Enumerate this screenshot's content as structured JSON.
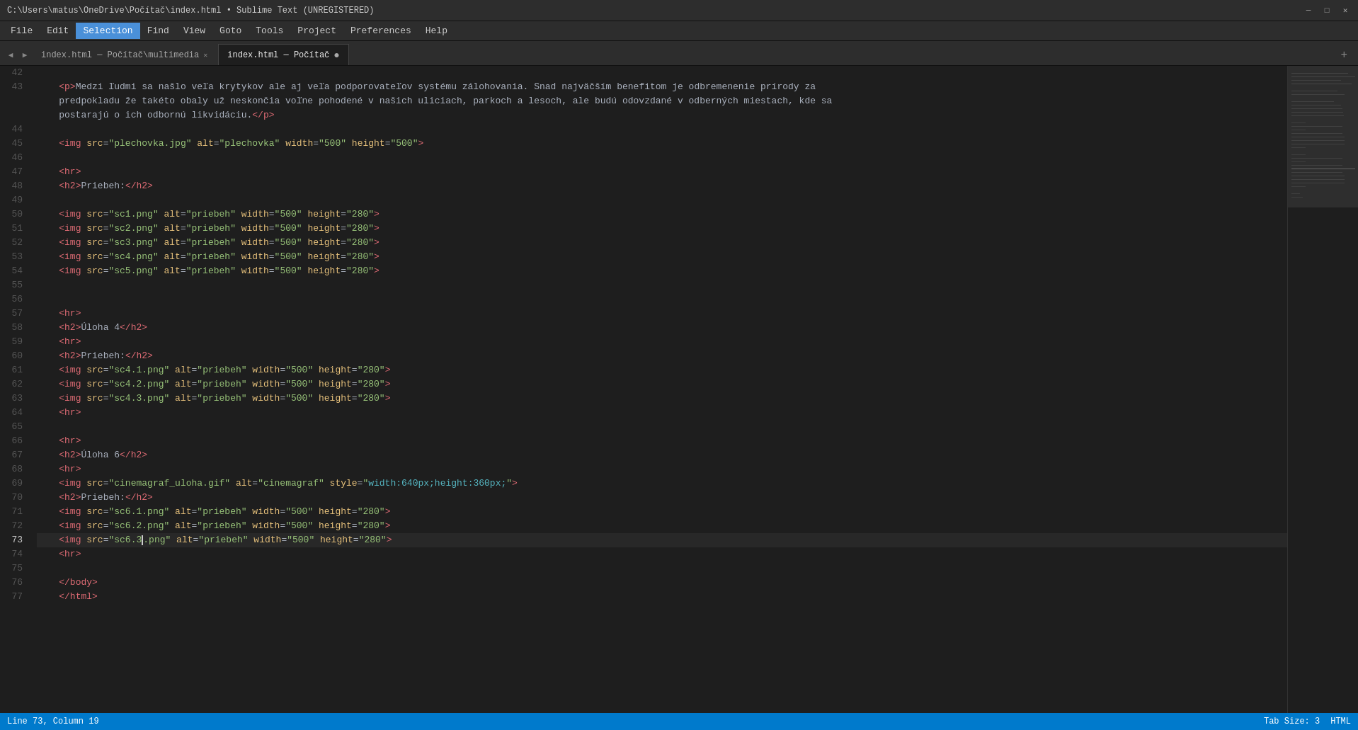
{
  "titlebar": {
    "title": "C:\\Users\\matus\\OneDrive\\Počítač\\index.html • Sublime Text (UNREGISTERED)",
    "min_label": "─",
    "max_label": "□",
    "close_label": "✕"
  },
  "menubar": {
    "items": [
      {
        "id": "file",
        "label": "File"
      },
      {
        "id": "edit",
        "label": "Edit"
      },
      {
        "id": "selection",
        "label": "Selection",
        "active": true
      },
      {
        "id": "find",
        "label": "Find"
      },
      {
        "id": "view",
        "label": "View"
      },
      {
        "id": "goto",
        "label": "Goto"
      },
      {
        "id": "tools",
        "label": "Tools"
      },
      {
        "id": "project",
        "label": "Project"
      },
      {
        "id": "preferences",
        "label": "Preferences"
      },
      {
        "id": "help",
        "label": "Help"
      }
    ]
  },
  "tabbar": {
    "tabs": [
      {
        "id": "tab1",
        "label": "index.html — Počítač\\multimedia",
        "active": false,
        "dirty": false
      },
      {
        "id": "tab2",
        "label": "index.html — Počítač",
        "active": true,
        "dirty": true
      }
    ]
  },
  "editor": {
    "lines": [
      {
        "num": 42,
        "content": ""
      },
      {
        "num": 43,
        "content": "    <p>Medzi ľudmi sa našlo veľa krytykov ale aj veľa podporovateľov systému zálohovania. Snad najväčším benefitom je odbremenenie prírody za"
      },
      {
        "num": "",
        "content": "    predpokladu že takéto obaly už neskončia voľne pohodené v našich uliciach, parkoch a lesoch, ale budú odovzdané v odberných miestach, kde sa"
      },
      {
        "num": "",
        "content": "    postarajú o ich odbornú likvidáciu.</p>"
      },
      {
        "num": 44,
        "content": ""
      },
      {
        "num": 45,
        "content": "    <img src=\"plechovka.jpg\" alt=\"plechovka\" width=\"500\" height=\"500\">"
      },
      {
        "num": 46,
        "content": ""
      },
      {
        "num": 47,
        "content": "    <hr>"
      },
      {
        "num": 48,
        "content": "    <h2>Priebeh:</h2>"
      },
      {
        "num": 49,
        "content": ""
      },
      {
        "num": 50,
        "content": "    <img src=\"sc1.png\" alt=\"priebeh\" width=\"500\" height=\"280\">"
      },
      {
        "num": 51,
        "content": "    <img src=\"sc2.png\" alt=\"priebeh\" width=\"500\" height=\"280\">"
      },
      {
        "num": 52,
        "content": "    <img src=\"sc3.png\" alt=\"priebeh\" width=\"500\" height=\"280\">"
      },
      {
        "num": 53,
        "content": "    <img src=\"sc4.png\" alt=\"priebeh\" width=\"500\" height=\"280\">"
      },
      {
        "num": 54,
        "content": "    <img src=\"sc5.png\" alt=\"priebeh\" width=\"500\" height=\"280\">"
      },
      {
        "num": 55,
        "content": ""
      },
      {
        "num": 56,
        "content": ""
      },
      {
        "num": 57,
        "content": "    <hr>"
      },
      {
        "num": 58,
        "content": "    <h2>Úloha 4</h2>"
      },
      {
        "num": 59,
        "content": "    <hr>"
      },
      {
        "num": 60,
        "content": "    <h2>Priebeh:</h2>"
      },
      {
        "num": 61,
        "content": "    <img src=\"sc4.1.png\" alt=\"priebeh\" width=\"500\" height=\"280\">"
      },
      {
        "num": 62,
        "content": "    <img src=\"sc4.2.png\" alt=\"priebeh\" width=\"500\" height=\"280\">"
      },
      {
        "num": 63,
        "content": "    <img src=\"sc4.3.png\" alt=\"priebeh\" width=\"500\" height=\"280\">"
      },
      {
        "num": 64,
        "content": "    <hr>"
      },
      {
        "num": 65,
        "content": ""
      },
      {
        "num": 66,
        "content": "    <hr>"
      },
      {
        "num": 67,
        "content": "    <h2>Úloha 6</h2>"
      },
      {
        "num": 68,
        "content": "    <hr>"
      },
      {
        "num": 69,
        "content": "    <img src=\"cinemagraf_uloha.gif\" alt=\"cinemagraf\" style=\"width:640px;height:360px;\">"
      },
      {
        "num": 70,
        "content": "    <h2>Priebeh:</h2>"
      },
      {
        "num": 71,
        "content": "    <img src=\"sc6.1.png\" alt=\"priebeh\" width=\"500\" height=\"280\">"
      },
      {
        "num": 72,
        "content": "    <img src=\"sc6.2.png\" alt=\"priebeh\" width=\"500\" height=\"280\">"
      },
      {
        "num": 73,
        "content": "    <img src=\"sc6.3.png\" alt=\"priebeh\" width=\"500\" height=\"280\">",
        "current": true
      },
      {
        "num": 74,
        "content": "    <hr>"
      },
      {
        "num": 75,
        "content": ""
      },
      {
        "num": 76,
        "content": "    </body>"
      },
      {
        "num": 77,
        "content": "    </html>"
      }
    ]
  },
  "statusbar": {
    "left": {
      "position": "Line 73, Column 19"
    },
    "right": {
      "tab_size": "Tab Size: 3",
      "encoding": "HTML"
    }
  }
}
